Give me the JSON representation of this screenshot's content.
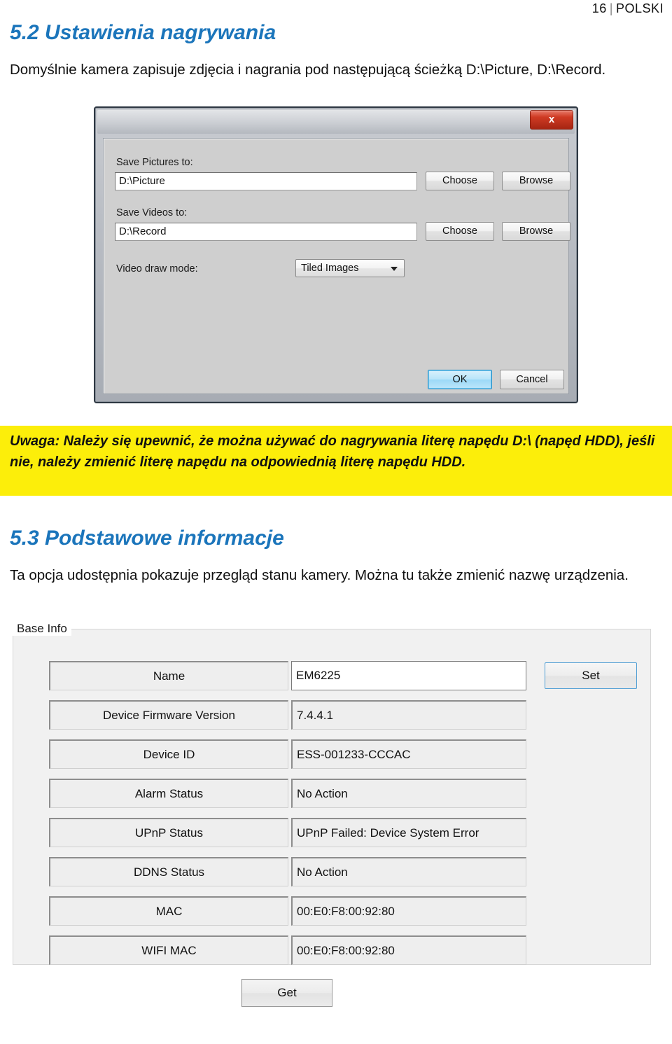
{
  "page_header": {
    "number": "16",
    "separator": "|",
    "language": "POLSKI"
  },
  "sections": {
    "s52": {
      "heading": "5.2 Ustawienia nagrywania",
      "paragraph": "Domyślnie kamera zapisuje zdjęcia i nagrania pod następującą ścieżką D:\\Picture, D:\\Record."
    },
    "s53": {
      "heading": "5.3 Podstawowe informacje",
      "paragraph": "Ta opcja udostępnia pokazuje przegląd stanu kamery. Można tu także zmienić nazwę urządzenia."
    }
  },
  "note": {
    "text": "Uwaga: Należy się upewnić, że można używać do nagrywania literę napędu D:\\ (napęd HDD), jeśli nie, należy zmienić literę napędu na odpowiednią literę napędu HDD.",
    "background": "#fcee0a"
  },
  "save_dialog": {
    "close_label": "x",
    "pictures_label": "Save Pictures to:",
    "pictures_value": "D:\\Picture",
    "pictures_choose": "Choose",
    "pictures_browse": "Browse",
    "videos_label": "Save Videos to:",
    "videos_value": "D:\\Record",
    "videos_choose": "Choose",
    "videos_browse": "Browse",
    "drawmode_label": "Video draw mode:",
    "drawmode_value": "Tiled Images",
    "drawmode_options": [
      "Tiled Images"
    ],
    "ok_label": "OK",
    "cancel_label": "Cancel"
  },
  "base_info": {
    "legend": "Base Info",
    "set_label": "Set",
    "get_label": "Get",
    "rows": [
      {
        "key": "Name",
        "value": "EM6225",
        "editable": true
      },
      {
        "key": "Device Firmware Version",
        "value": "7.4.4.1",
        "editable": false
      },
      {
        "key": "Device ID",
        "value": "ESS-001233-CCCAC",
        "editable": false
      },
      {
        "key": "Alarm Status",
        "value": "No Action",
        "editable": false
      },
      {
        "key": "UPnP Status",
        "value": "UPnP Failed: Device System Error",
        "editable": false
      },
      {
        "key": "DDNS Status",
        "value": "No Action",
        "editable": false
      },
      {
        "key": "MAC",
        "value": "00:E0:F8:00:92:80",
        "editable": false
      },
      {
        "key": "WIFI MAC",
        "value": "00:E0:F8:00:92:80",
        "editable": false
      }
    ]
  }
}
